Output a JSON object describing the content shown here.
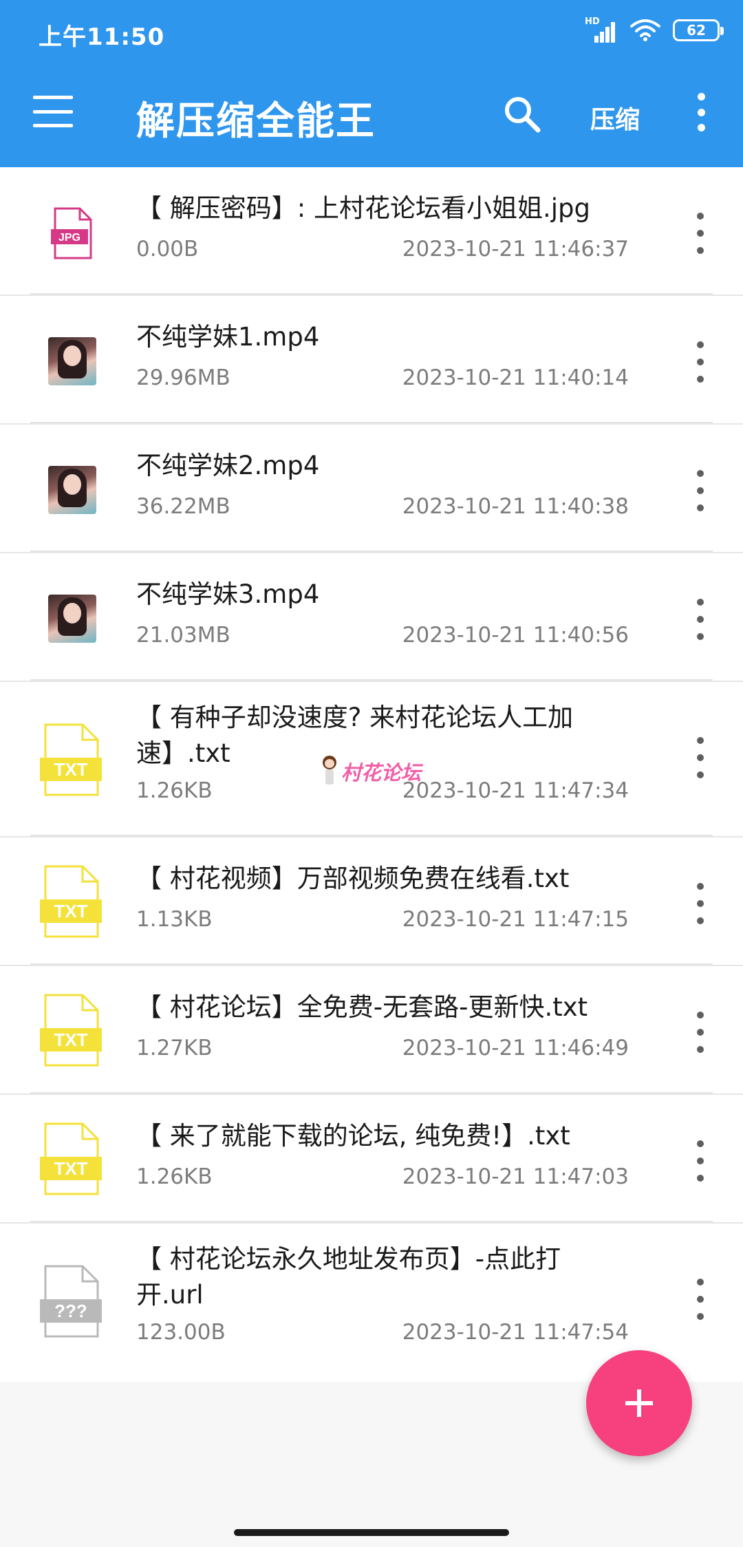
{
  "status_bar": {
    "time": "上午11:50",
    "network": "HD",
    "battery": "62"
  },
  "toolbar": {
    "title": "解压缩全能王",
    "compress_label": "压缩",
    "icons": [
      "menu-icon",
      "search-icon",
      "more-vert-icon"
    ]
  },
  "files": [
    {
      "name": "【 解压密码】: 上村花论坛看小姐姐.jpg",
      "size": "0.00B",
      "date": "2023-10-21 11:46:37",
      "type": "jpg",
      "icon_label": "JPG"
    },
    {
      "name": "不纯学妹1.mp4",
      "size": "29.96MB",
      "date": "2023-10-21 11:40:14",
      "type": "video"
    },
    {
      "name": "不纯学妹2.mp4",
      "size": "36.22MB",
      "date": "2023-10-21 11:40:38",
      "type": "video"
    },
    {
      "name": "不纯学妹3.mp4",
      "size": "21.03MB",
      "date": "2023-10-21 11:40:56",
      "type": "video"
    },
    {
      "name": "【 有种子却没速度? 来村花论坛人工加速】.txt",
      "size": "1.26KB",
      "date": "2023-10-21 11:47:34",
      "type": "txt",
      "icon_label": "TXT"
    },
    {
      "name": "【 村花视频】万部视频免费在线看.txt",
      "size": "1.13KB",
      "date": "2023-10-21 11:47:15",
      "type": "txt",
      "icon_label": "TXT"
    },
    {
      "name": "【 村花论坛】全免费-无套路-更新快.txt",
      "size": "1.27KB",
      "date": "2023-10-21 11:46:49",
      "type": "txt",
      "icon_label": "TXT"
    },
    {
      "name": "【 来了就能下载的论坛, 纯免费!】.txt",
      "size": "1.26KB",
      "date": "2023-10-21 11:47:03",
      "type": "txt",
      "icon_label": "TXT"
    },
    {
      "name": "【 村花论坛永久地址发布页】-点此打开.url",
      "size": "123.00B",
      "date": "2023-10-21 11:47:54",
      "type": "unknown",
      "icon_label": "???"
    }
  ],
  "watermark": "村花论坛",
  "colors": {
    "appbar": "#2f96ee",
    "fab": "#f7417e",
    "txt_icon": "#f4e13a",
    "jpg_icon": "#d63a86",
    "unknown_icon": "#b9b9b9"
  }
}
